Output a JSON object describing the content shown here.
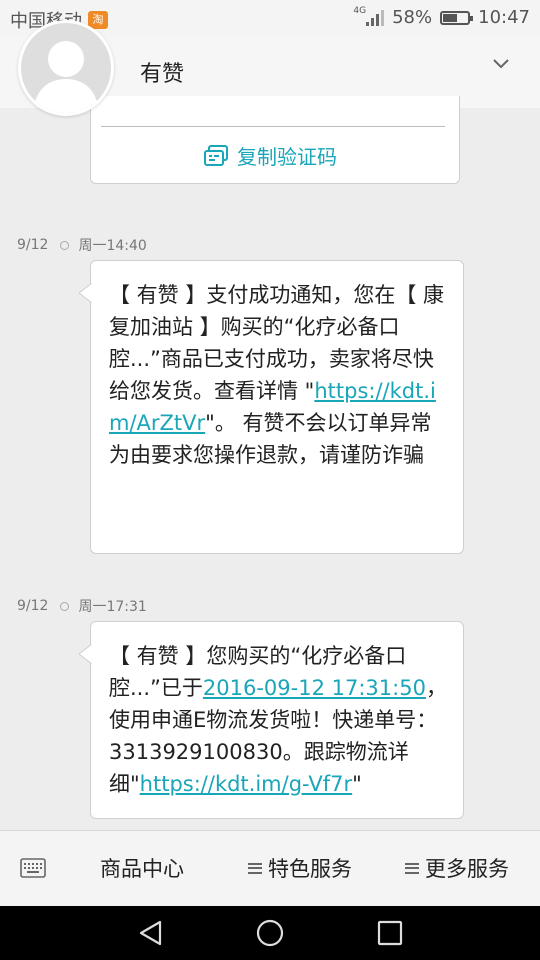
{
  "status_bar": {
    "carrier": "中国移动",
    "carrier_badge": "淘",
    "network": "4G",
    "battery_percent": "58%",
    "battery_level": 0.58,
    "time": "10:47"
  },
  "header": {
    "contact_name": "有赞",
    "expand_icon": "chevron-down-icon"
  },
  "top_card": {
    "copy_label": "复制验证码",
    "copy_icon": "copy-code-icon"
  },
  "messages": [
    {
      "date": "9/12",
      "time": "周一14:40",
      "parts": [
        {
          "text": "【 有赞 】支付成功通知，您在【 康复加油站 】购买的“化疗必备口腔...”商品已支付成功，卖家将尽快给您发货。查看详情 \"",
          "link": false
        },
        {
          "text": "https://kdt.im/ArZtVr",
          "link": true
        },
        {
          "text": "\"。 有赞不会以订单异常为由要求您操作退款，请谨防诈骗",
          "link": false
        }
      ]
    },
    {
      "date": "9/12",
      "time": "周一17:31",
      "parts": [
        {
          "text": "【 有赞 】您购买的“化疗必备口腔...”已于",
          "link": false
        },
        {
          "text": "2016-09-12 17:31:50",
          "link": true
        },
        {
          "text": "，使用申通E物流发货啦！快递单号：3313929100830。跟踪物流详细\"",
          "link": false
        },
        {
          "text": "https://kdt.im/g-Vf7r",
          "link": true
        },
        {
          "text": "\"",
          "link": false
        }
      ]
    }
  ],
  "menu": {
    "keyboard_icon": "keyboard-icon",
    "items": [
      {
        "label": "商品中心",
        "has_icon": false
      },
      {
        "label": "特色服务",
        "has_icon": true
      },
      {
        "label": "更多服务",
        "has_icon": true
      }
    ]
  },
  "nav": {
    "back_icon": "back-icon",
    "home_icon": "home-icon",
    "recents_icon": "recents-icon"
  },
  "colors": {
    "link": "#19a6b8",
    "background": "#ededed",
    "bubble": "#ffffff"
  }
}
